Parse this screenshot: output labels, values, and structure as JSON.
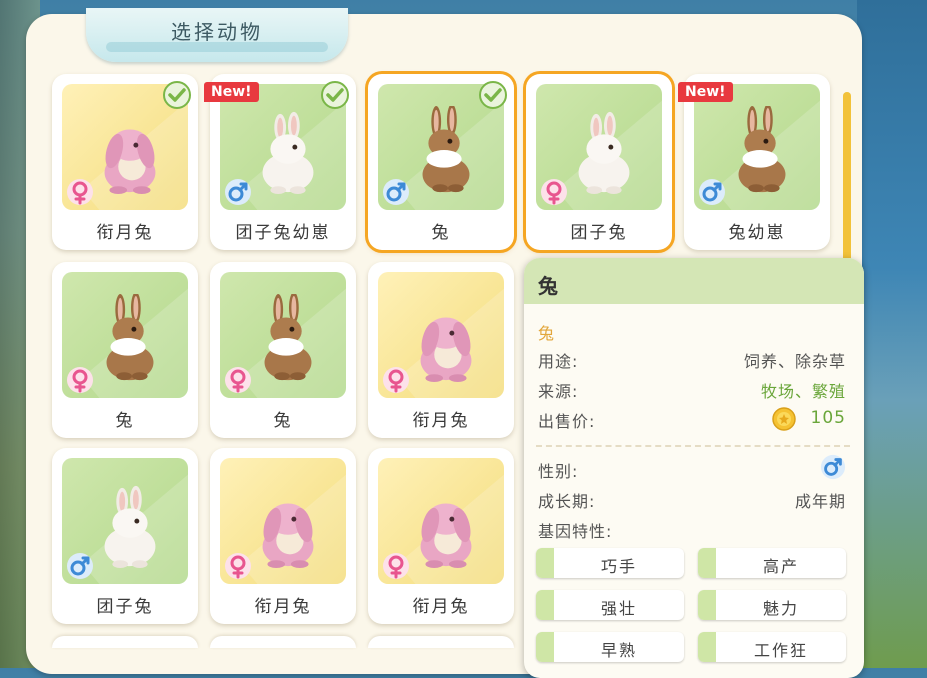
{
  "panel": {
    "title": "选择动物"
  },
  "colors": {
    "selected_border": "#f5a623",
    "new_badge": "#e8393f",
    "female": "#e8558f",
    "male": "#3d8ad6",
    "check": "#7ab648",
    "green_text": "#6aa63a",
    "subtitle": "#e2a63a"
  },
  "icons": {
    "check": "check-icon",
    "female": "female-icon",
    "male": "male-icon",
    "coin": "coin-icon",
    "new": "new-badge"
  },
  "animals": [
    {
      "name": "衔月兔",
      "bg": "yellow",
      "breed": "lop",
      "gender": "female",
      "new": false,
      "checked": true,
      "selected": false
    },
    {
      "name": "团子兔幼崽",
      "bg": "green",
      "breed": "white",
      "gender": "male",
      "new": true,
      "checked": true,
      "selected": false
    },
    {
      "name": "兔",
      "bg": "green",
      "breed": "brown",
      "gender": "male",
      "new": false,
      "checked": true,
      "selected": true
    },
    {
      "name": "团子兔",
      "bg": "green",
      "breed": "white",
      "gender": "female",
      "new": false,
      "checked": false,
      "selected": true
    },
    {
      "name": "兔幼崽",
      "bg": "green",
      "breed": "brown",
      "gender": "male",
      "new": true,
      "checked": false,
      "selected": false
    },
    {
      "name": "兔",
      "bg": "green",
      "breed": "brown",
      "gender": "female",
      "new": false,
      "checked": false,
      "selected": false
    },
    {
      "name": "兔",
      "bg": "green",
      "breed": "brown",
      "gender": "female",
      "new": false,
      "checked": false,
      "selected": false
    },
    {
      "name": "衔月兔",
      "bg": "yellow",
      "breed": "lop",
      "gender": "female",
      "new": false,
      "checked": false,
      "selected": false
    },
    {
      "name": "团子兔",
      "bg": "green",
      "breed": "white",
      "gender": "male",
      "new": false,
      "checked": false,
      "selected": false
    },
    {
      "name": "衔月兔",
      "bg": "yellow",
      "breed": "lop",
      "gender": "female",
      "new": false,
      "checked": false,
      "selected": false
    },
    {
      "name": "衔月兔",
      "bg": "yellow",
      "breed": "lop",
      "gender": "female",
      "new": false,
      "checked": false,
      "selected": false
    }
  ],
  "new_label": "New!",
  "detail": {
    "title": "兔",
    "subtitle": "兔",
    "usage_label": "用途:",
    "usage_value": "饲养、除杂草",
    "source_label": "来源:",
    "source_value": "牧场、繁殖",
    "price_label": "出售价:",
    "price_value": "105",
    "gender_label": "性别:",
    "gender_value": "male",
    "growth_label": "成长期:",
    "growth_value": "成年期",
    "genes_label": "基因特性:",
    "genes": [
      "巧手",
      "高产",
      "强壮",
      "魅力",
      "早熟",
      "工作狂"
    ]
  }
}
